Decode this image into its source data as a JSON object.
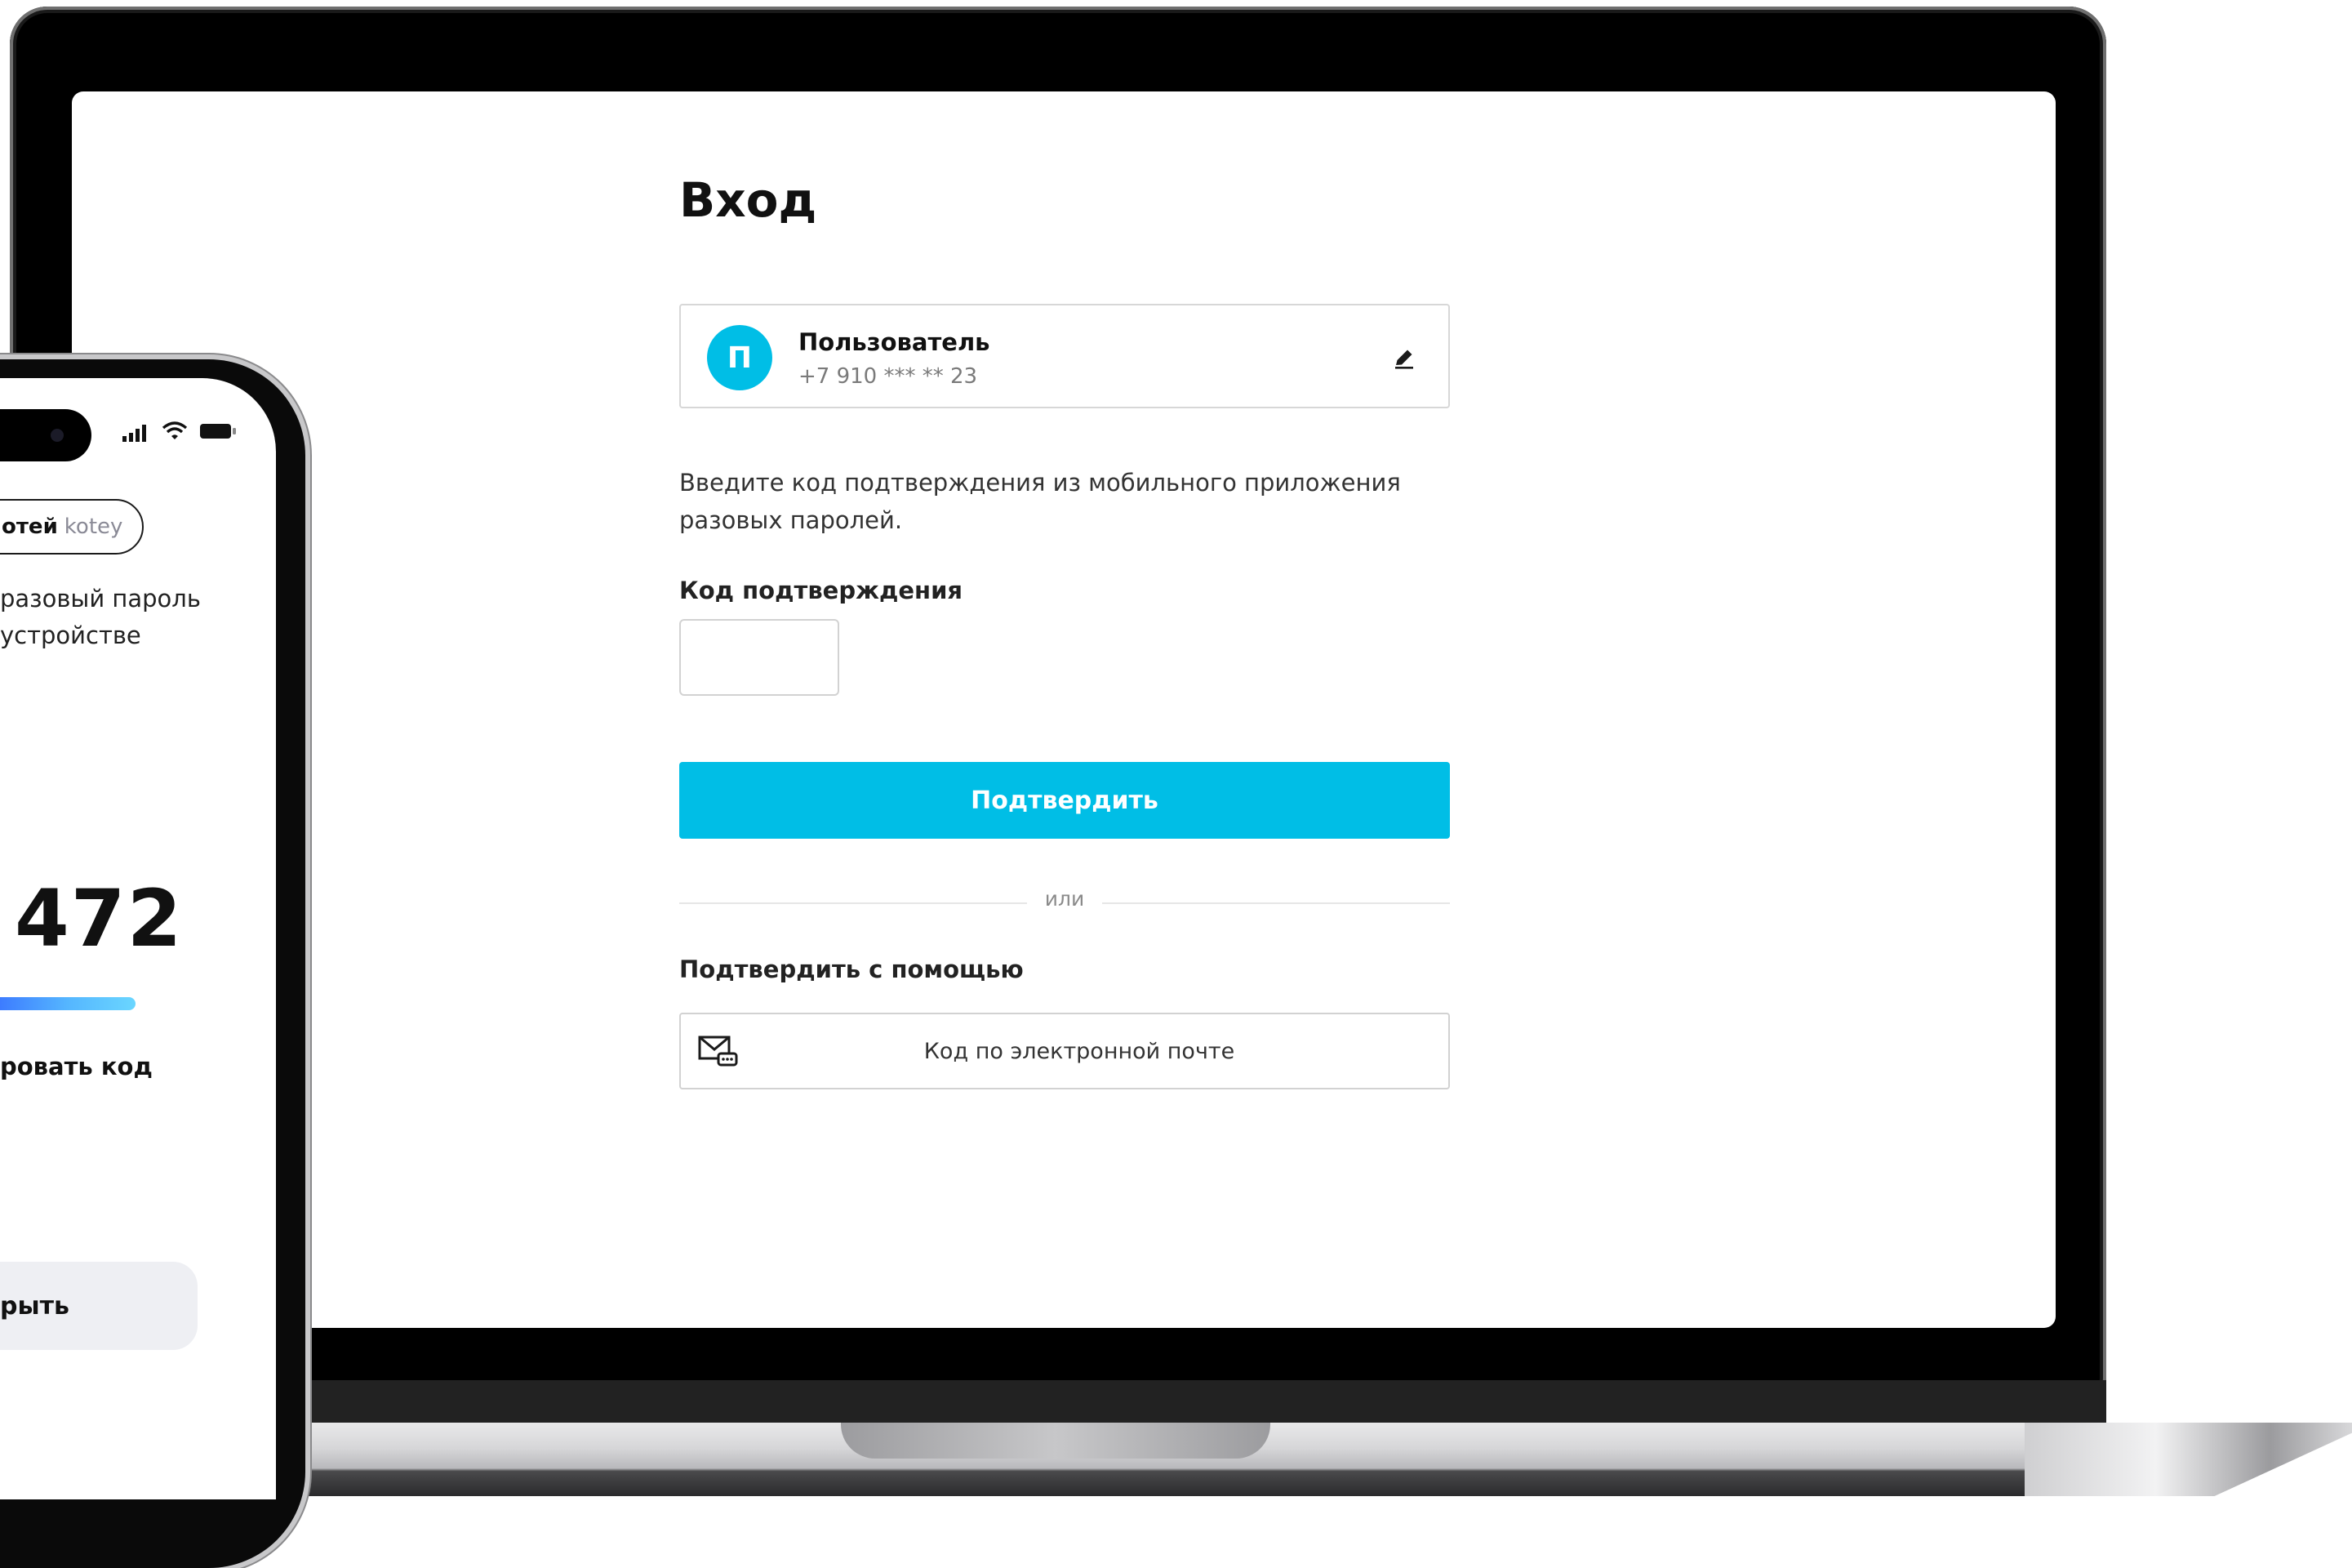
{
  "login": {
    "title": "Вход",
    "user": {
      "avatar_initial": "П",
      "name": "Пользователь",
      "phone": "+7 910 *** ** 23"
    },
    "instructions": "Введите код подтверждения из мобильного приложения разовых паролей.",
    "code_label": "Код подтверждения",
    "code_value": "",
    "confirm_label": "Подтвердить",
    "divider_text": "или",
    "confirm_with_label": "Подтвердить с помощью",
    "email_option_label": "Код по электронной почте"
  },
  "phone": {
    "chip_name": "отей",
    "chip_login": "kotey",
    "otp_caption": "разовый пароль устройстве",
    "otp_code": "472",
    "otp_remaining": 0.45,
    "copy_label": "ровать код",
    "close_label": "рыть"
  },
  "colors": {
    "accent": "#00bee6",
    "border": "#d7d7d7",
    "progress_start": "#3d7cff",
    "progress_end": "#6ad6ff"
  },
  "icons": {
    "edit": "pencil-icon",
    "email": "envelope-chat-icon",
    "signal": "signal-icon",
    "wifi": "wifi-icon",
    "battery": "battery-icon"
  }
}
